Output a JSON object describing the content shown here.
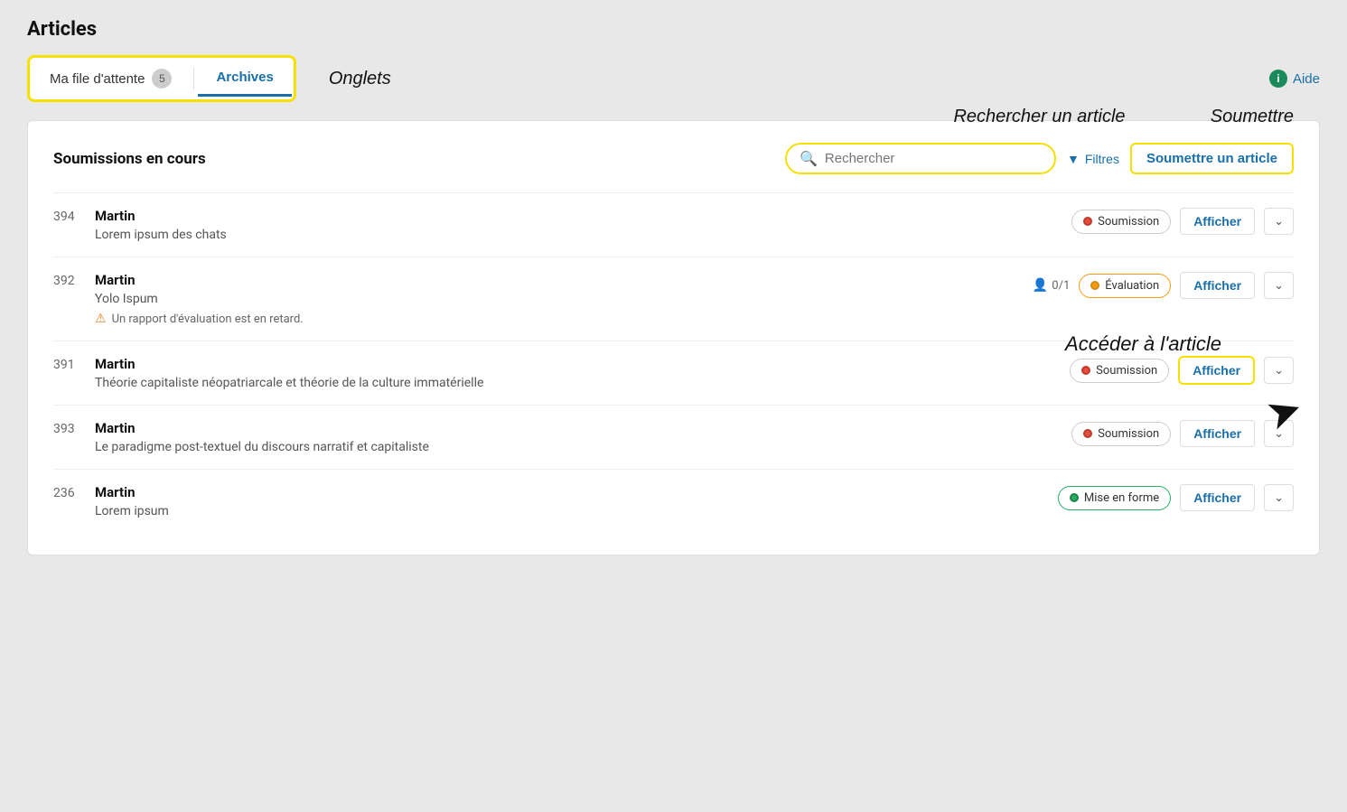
{
  "page": {
    "title": "Articles"
  },
  "header": {
    "help_label": "Aide",
    "annotation_onglets": "Onglets",
    "annotation_rechercher": "Rechercher un article",
    "annotation_soumettre": "Soumettre",
    "annotation_acceder": "Accéder à l'article"
  },
  "tabs": [
    {
      "id": "queue",
      "label": "Ma file d'attente",
      "badge": "5",
      "active": false
    },
    {
      "id": "archives",
      "label": "Archives",
      "badge": null,
      "active": true
    }
  ],
  "toolbar": {
    "search_placeholder": "Rechercher",
    "filters_label": "Filtres",
    "submit_label": "Soumettre un article",
    "section_title": "Soumissions en cours"
  },
  "submissions": [
    {
      "id": "394",
      "author": "Martin",
      "title": "Lorem ipsum des chats",
      "status_label": "Soumission",
      "status_color": "red",
      "reviewer_count": null,
      "warning": null,
      "view_label": "Afficher",
      "highlighted": false
    },
    {
      "id": "392",
      "author": "Martin",
      "title": "Yolo Ispum",
      "status_label": "Évaluation",
      "status_color": "orange",
      "reviewer_count": "0/1",
      "warning": "Un rapport d'évaluation est en retard.",
      "view_label": "Afficher",
      "highlighted": false
    },
    {
      "id": "391",
      "author": "Martin",
      "title": "Théorie capitaliste néopatriarcale et théorie de la culture immatérielle",
      "status_label": "Soumission",
      "status_color": "red",
      "reviewer_count": null,
      "warning": null,
      "view_label": "Afficher",
      "highlighted": true
    },
    {
      "id": "393",
      "author": "Martin",
      "title": "Le paradigme post-textuel du discours narratif et capitaliste",
      "status_label": "Soumission",
      "status_color": "red",
      "reviewer_count": null,
      "warning": null,
      "view_label": "Afficher",
      "highlighted": false
    },
    {
      "id": "236",
      "author": "Martin",
      "title": "Lorem ipsum",
      "status_label": "Mise en forme",
      "status_color": "green",
      "reviewer_count": null,
      "warning": null,
      "view_label": "Afficher",
      "highlighted": false
    }
  ]
}
